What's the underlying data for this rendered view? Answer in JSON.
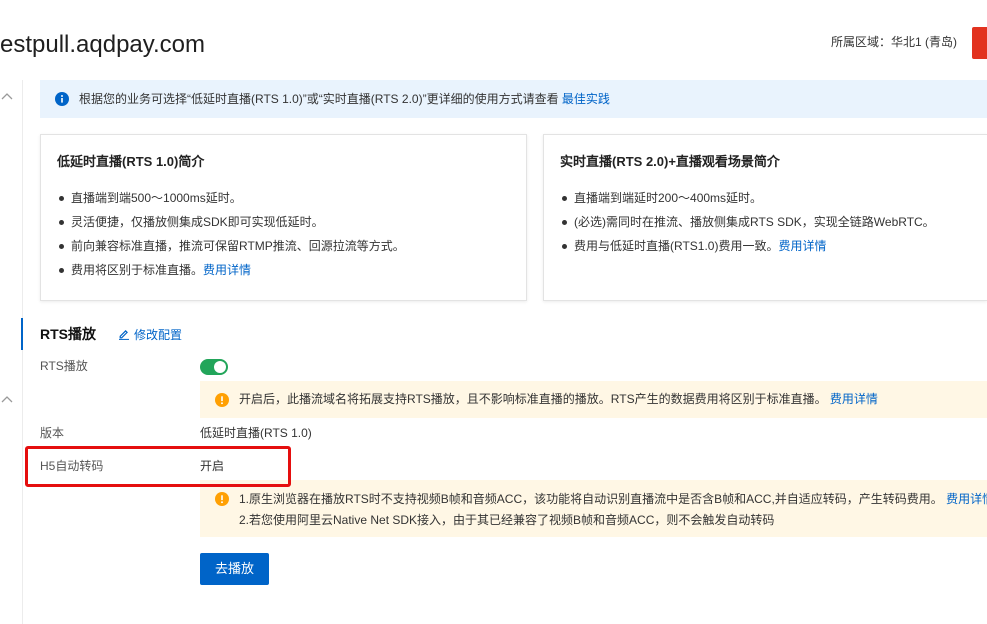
{
  "header": {
    "domain": "estpull.aqdpay.com",
    "region_label": "所属区域：",
    "region_value": "华北1 (青岛)"
  },
  "info_bar": {
    "text": "根据您的业务可选择“低延时直播(RTS 1.0)”或“实时直播(RTS 2.0)”更详细的使用方式请查看",
    "link": "最佳实践"
  },
  "cards": [
    {
      "title": "低延时直播(RTS 1.0)简介",
      "items": [
        {
          "text": "直播端到端500～1000ms延时。"
        },
        {
          "text": "灵活便捷，仅播放侧集成SDK即可实现低延时。"
        },
        {
          "text": "前向兼容标准直播，推流可保留RTMP推流、回源拉流等方式。"
        },
        {
          "text": "费用将区别于标准直播。",
          "link": "费用详情"
        }
      ]
    },
    {
      "title": "实时直播(RTS 2.0)+直播观看场景简介",
      "items": [
        {
          "text": "直播端到端延时200～400ms延时。"
        },
        {
          "text": "(必选)需同时在推流、播放侧集成RTS SDK，实现全链路WebRTC。"
        },
        {
          "text": "费用与低延时直播(RTS1.0)费用一致。",
          "link": "费用详情"
        }
      ]
    }
  ],
  "rts_section": {
    "title": "RTS播放",
    "edit_label": "修改配置",
    "rts_play": {
      "label": "RTS播放",
      "enabled": true
    },
    "rts_notice": {
      "text": "开启后，此播流域名将拓展支持RTS播放，且不影响标准直播的播放。RTS产生的数据费用将区别于标准直播。",
      "link": "费用详情"
    },
    "version": {
      "label": "版本",
      "value": "低延时直播(RTS 1.0)"
    },
    "h5_transcode": {
      "label": "H5自动转码",
      "value": "开启"
    },
    "h5_notice": {
      "line1": "1.原生浏览器在播放RTS时不支持视频B帧和音频ACC，该功能将自动识别直播流中是否含B帧和ACC,并自适应转码，产生转码费用。",
      "line1_link": "费用详情",
      "line2": "2.若您使用阿里云Native Net SDK接入，由于其已经兼容了视频B帧和音频ACC，则不会触发自动转码"
    },
    "play_button": "去播放"
  },
  "colors": {
    "accent": "#0064c8",
    "brand_red": "#e2321f",
    "info_bg": "#e9f3fd",
    "warning_bg": "#fff7e5",
    "warning": "#ffa003",
    "toggle_on": "#22a55a",
    "highlight": "#e50e0e"
  },
  "icons": [
    "chevron-up-icon",
    "info-icon",
    "edit-icon",
    "warning-icon"
  ]
}
